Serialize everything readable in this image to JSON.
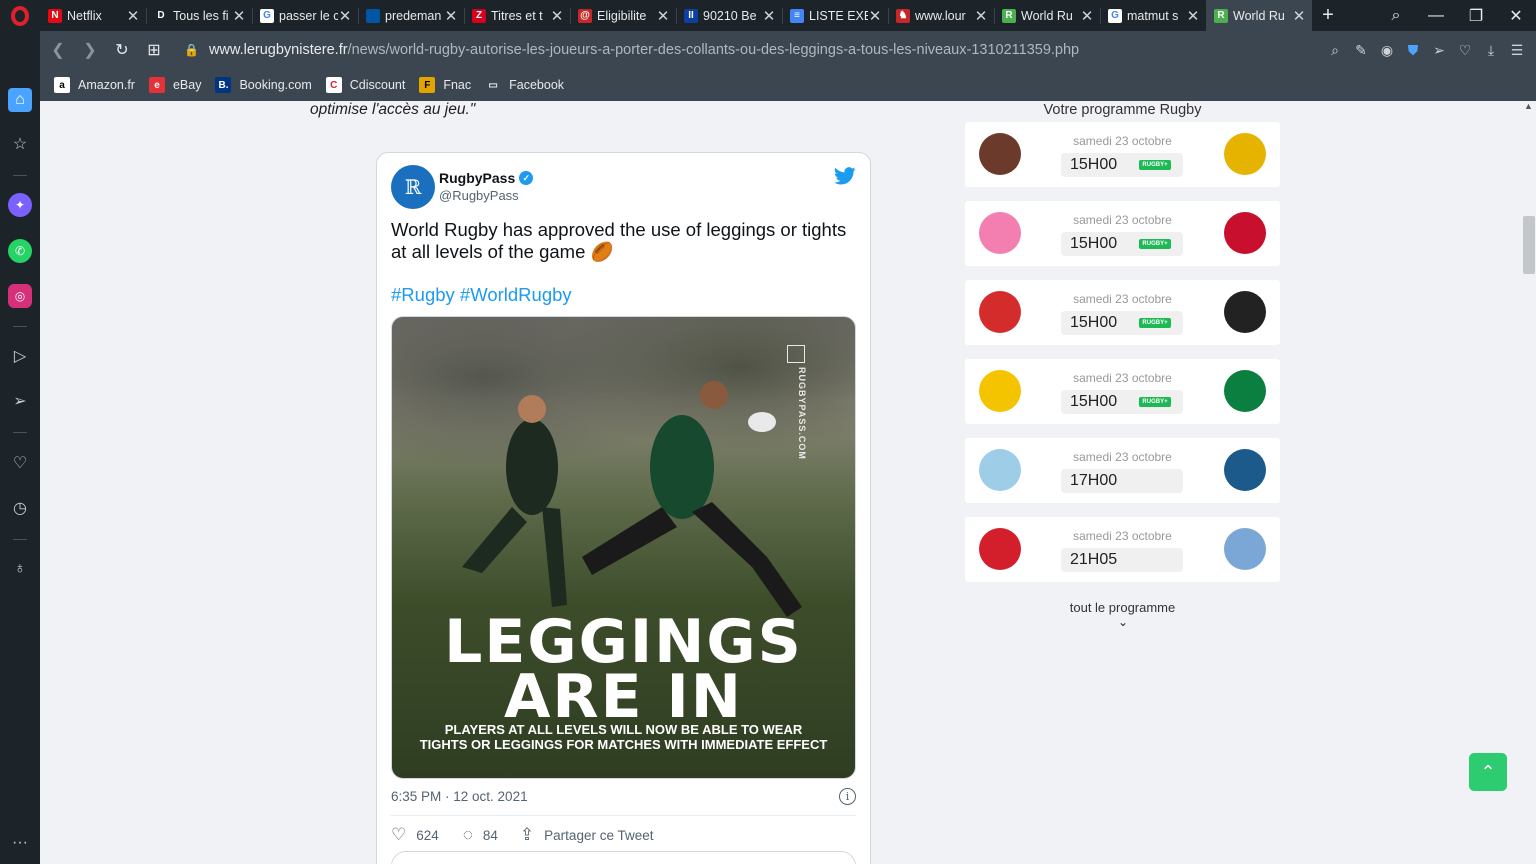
{
  "tabs": [
    {
      "title": "Netflix",
      "icon": "netflix-icon",
      "color": "#e50914",
      "glyph": "N"
    },
    {
      "title": "Tous les fi",
      "icon": "disney-icon",
      "color": "#1c2329",
      "glyph": "D"
    },
    {
      "title": "passer le c",
      "icon": "google-icon",
      "color": "#ffffff",
      "glyph": "G"
    },
    {
      "title": "predeman",
      "icon": "france-flag-icon",
      "color": "#0055a4",
      "glyph": ""
    },
    {
      "title": "Titres et t",
      "icon": "tf1-icon",
      "color": "#d6001c",
      "glyph": "Z"
    },
    {
      "title": "Eligibilite",
      "icon": "site-icon",
      "color": "#c62828",
      "glyph": "@"
    },
    {
      "title": "90210 Be",
      "icon": "site-icon",
      "color": "#0d3fa0",
      "glyph": "II"
    },
    {
      "title": "LISTE EXE",
      "icon": "docs-icon",
      "color": "#4285f4",
      "glyph": "≡"
    },
    {
      "title": "www.lour",
      "icon": "site-icon",
      "color": "#c62828",
      "glyph": "♞"
    },
    {
      "title": "World Ru",
      "icon": "rugby-site-icon",
      "color": "#4caf50",
      "glyph": "R"
    },
    {
      "title": "matmut s",
      "icon": "google-icon",
      "color": "#ffffff",
      "glyph": "G"
    },
    {
      "title": "World Ru",
      "icon": "rugby-site-icon",
      "color": "#4caf50",
      "glyph": "R",
      "active": true
    }
  ],
  "address": {
    "domain": "www.lerugbynistere.fr",
    "path": "/news/world-rugby-autorise-les-joueurs-a-porter-des-collants-ou-des-leggings-a-tous-les-niveaux-1310211359.php"
  },
  "bookmarks": [
    {
      "label": "Amazon.fr",
      "glyph": "a",
      "bg": "#ffffff",
      "fg": "#000000"
    },
    {
      "label": "eBay",
      "glyph": "e",
      "bg": "#e53238",
      "fg": "#ffffff"
    },
    {
      "label": "Booking.com",
      "glyph": "B.",
      "bg": "#003580",
      "fg": "#ffffff"
    },
    {
      "label": "Cdiscount",
      "glyph": "C",
      "bg": "#ffffff",
      "fg": "#d81e2c"
    },
    {
      "label": "Fnac",
      "glyph": "F",
      "bg": "#e1a400",
      "fg": "#000000"
    },
    {
      "label": "Facebook",
      "glyph": "▭",
      "bg": "#3c4650",
      "fg": "#e8eaed"
    }
  ],
  "article": {
    "quote_tail": "optimise l'accès au jeu.\""
  },
  "tweet": {
    "name": "RugbyPass",
    "handle": "@RugbyPass",
    "text": "World Rugby has approved the use of leggings or tights at all levels of the game 🏉",
    "hashtags": "#Rugby #WorldRugby",
    "media": {
      "brand": "RUGBYPASS.COM",
      "headline_line1": "LEGGINGS",
      "headline_line2": "ARE IN",
      "subline1": "PLAYERS AT ALL LEVELS WILL NOW BE ABLE TO WEAR",
      "subline2": "TIGHTS OR LEGGINGS FOR MATCHES WITH IMMEDIATE EFFECT"
    },
    "timestamp": "6:35 PM · 12 oct. 2021",
    "likes": "624",
    "replies": "84",
    "share_label": "Partager ce Tweet"
  },
  "programme": {
    "title": "Votre programme Rugby",
    "matches": [
      {
        "date": "samedi 23 octobre",
        "time": "15H00",
        "tv": true,
        "home_color": "#6b3a2a",
        "away_color": "#e6b400"
      },
      {
        "date": "samedi 23 octobre",
        "time": "15H00",
        "tv": true,
        "home_color": "#f27fb0",
        "away_color": "#c8102e"
      },
      {
        "date": "samedi 23 octobre",
        "time": "15H00",
        "tv": true,
        "home_color": "#d42b2b",
        "away_color": "#222222"
      },
      {
        "date": "samedi 23 octobre",
        "time": "15H00",
        "tv": true,
        "home_color": "#f5c400",
        "away_color": "#0a7f3f"
      },
      {
        "date": "samedi 23 octobre",
        "time": "17H00",
        "tv": false,
        "home_color": "#9ecde8",
        "away_color": "#1c5a8c"
      },
      {
        "date": "samedi 23 octobre",
        "time": "21H05",
        "tv": false,
        "home_color": "#d21f2b",
        "away_color": "#7ba7d6"
      }
    ],
    "tv_label": "RUGBY+",
    "all_label": "tout le programme"
  }
}
